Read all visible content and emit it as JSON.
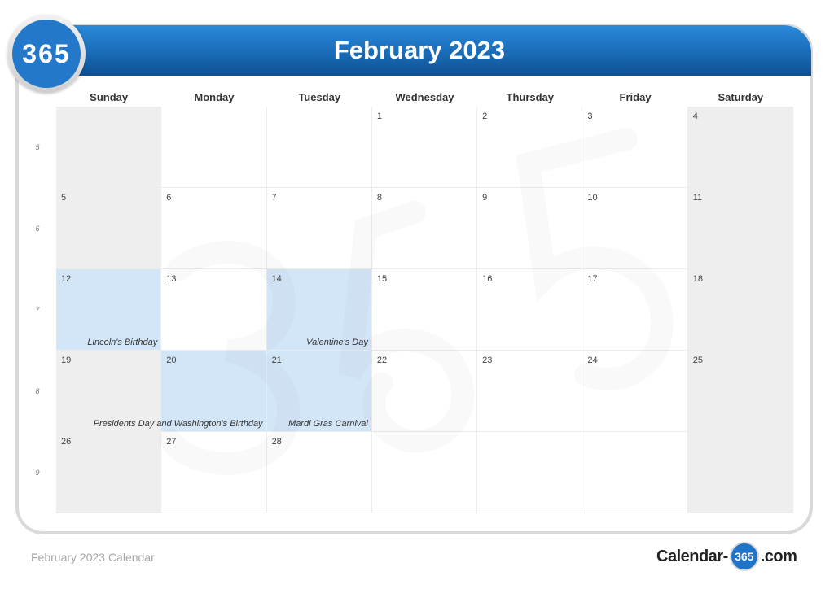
{
  "header": {
    "badge_text": "365",
    "title": "February 2023"
  },
  "days_of_week": [
    "Sunday",
    "Monday",
    "Tuesday",
    "Wednesday",
    "Thursday",
    "Friday",
    "Saturday"
  ],
  "week_numbers": [
    "5",
    "6",
    "7",
    "8",
    "9"
  ],
  "weeks": [
    [
      {
        "d": "",
        "t": "weekend"
      },
      {
        "d": ""
      },
      {
        "d": ""
      },
      {
        "d": "1"
      },
      {
        "d": "2"
      },
      {
        "d": "3"
      },
      {
        "d": "4",
        "t": "weekend"
      }
    ],
    [
      {
        "d": "5",
        "t": "weekend"
      },
      {
        "d": "6"
      },
      {
        "d": "7"
      },
      {
        "d": "8"
      },
      {
        "d": "9"
      },
      {
        "d": "10"
      },
      {
        "d": "11",
        "t": "weekend"
      }
    ],
    [
      {
        "d": "12",
        "t": "holiday",
        "e": "Lincoln's Birthday"
      },
      {
        "d": "13"
      },
      {
        "d": "14",
        "t": "holiday",
        "e": "Valentine's Day"
      },
      {
        "d": "15"
      },
      {
        "d": "16"
      },
      {
        "d": "17"
      },
      {
        "d": "18",
        "t": "weekend"
      }
    ],
    [
      {
        "d": "19",
        "t": "weekend"
      },
      {
        "d": "20",
        "t": "holiday",
        "e": "Presidents Day and Washington's Birthday"
      },
      {
        "d": "21",
        "t": "holiday",
        "e": "Mardi Gras Carnival"
      },
      {
        "d": "22"
      },
      {
        "d": "23"
      },
      {
        "d": "24"
      },
      {
        "d": "25",
        "t": "weekend"
      }
    ],
    [
      {
        "d": "26",
        "t": "weekend"
      },
      {
        "d": "27"
      },
      {
        "d": "28"
      },
      {
        "d": ""
      },
      {
        "d": ""
      },
      {
        "d": ""
      },
      {
        "d": "",
        "t": "weekend"
      }
    ]
  ],
  "footer": {
    "caption": "February 2023 Calendar",
    "logo_left": "Calendar-",
    "logo_badge": "365",
    "logo_right": ".com"
  },
  "colors": {
    "header_blue": "#1a6cb8",
    "holiday_fill": "#d3e6f8",
    "weekend_fill": "#ececec"
  }
}
